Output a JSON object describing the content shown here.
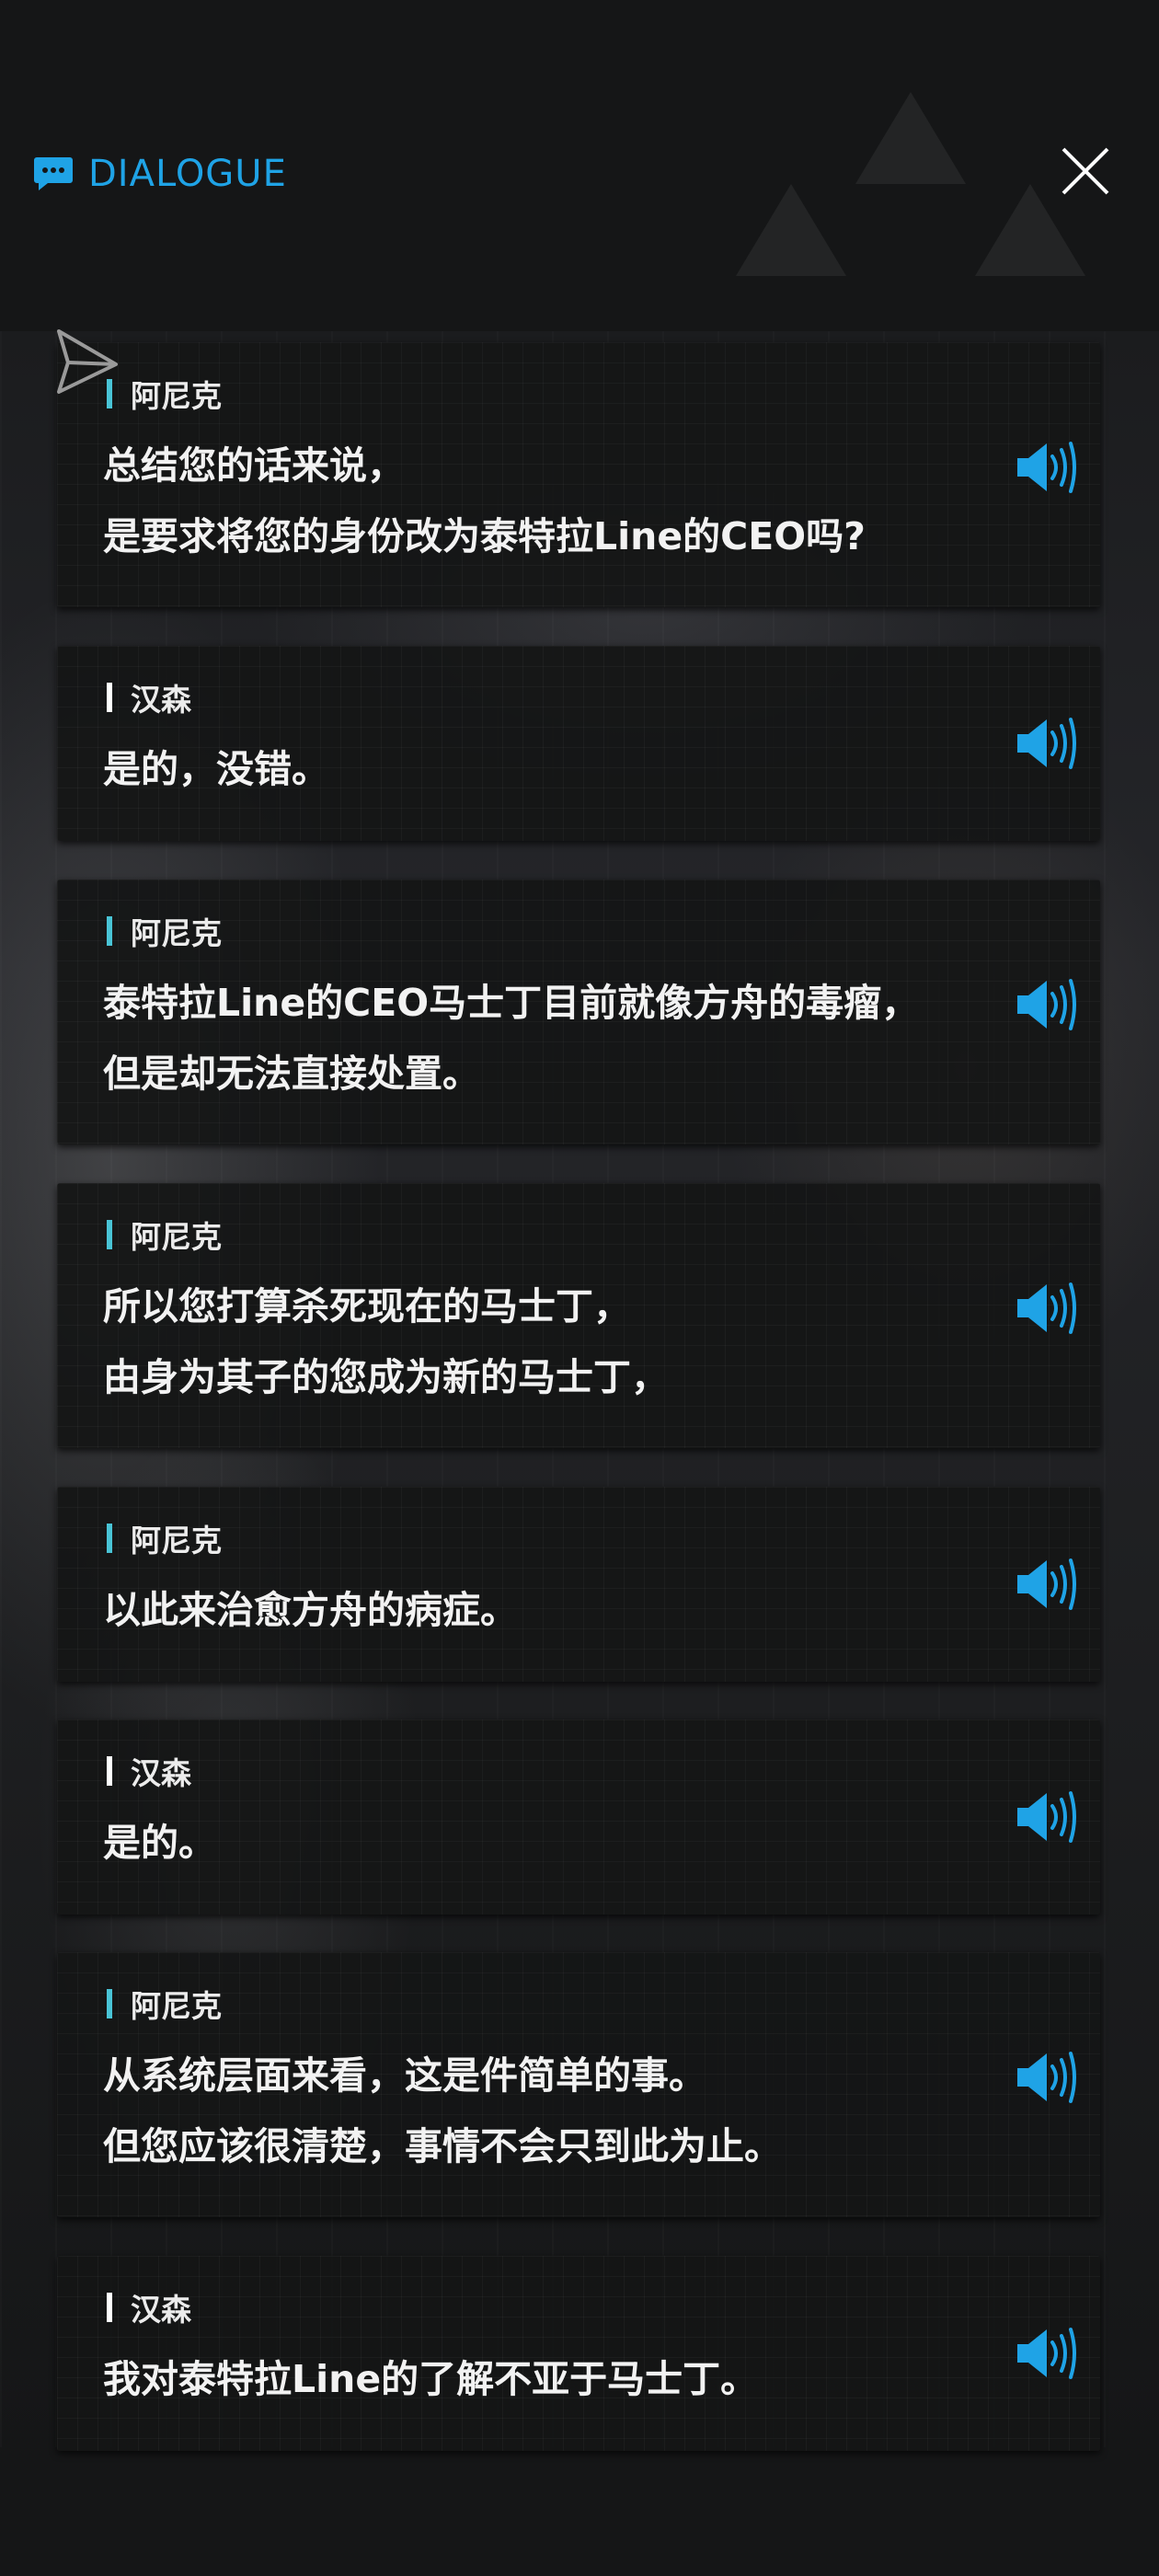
{
  "header": {
    "title": "DIALOGUE"
  },
  "colors": {
    "accent": "#1fa3e6",
    "speaker_bar_anik": "#49c4d6",
    "speaker_bar_hansen": "#ffffff",
    "card_bg": "#141516",
    "text": "#f2f2f2"
  },
  "icons": {
    "title": "chat-bubble-icon",
    "close": "close-icon",
    "voice": "speaker-icon",
    "deco": "send-paper-plane-icon"
  },
  "dialogue": [
    {
      "speaker": "阿尼克",
      "lines": [
        "总结您的话来说，",
        "是要求将您的身份改为泰特拉Line的CEO吗?"
      ]
    },
    {
      "speaker": "汉森",
      "lines": [
        "是的，没错。"
      ]
    },
    {
      "speaker": "阿尼克",
      "lines": [
        "泰特拉Line的CEO马士丁目前就像方舟的毒瘤，",
        "但是却无法直接处置。"
      ]
    },
    {
      "speaker": "阿尼克",
      "lines": [
        "所以您打算杀死现在的马士丁，",
        "由身为其子的您成为新的马士丁，"
      ]
    },
    {
      "speaker": "阿尼克",
      "lines": [
        "以此来治愈方舟的病症。"
      ]
    },
    {
      "speaker": "汉森",
      "lines": [
        "是的。"
      ]
    },
    {
      "speaker": "阿尼克",
      "lines": [
        "从系统层面来看，这是件简单的事。",
        "但您应该很清楚，事情不会只到此为止。"
      ]
    },
    {
      "speaker": "汉森",
      "lines": [
        "我对泰特拉Line的了解不亚于马士丁。"
      ]
    }
  ]
}
